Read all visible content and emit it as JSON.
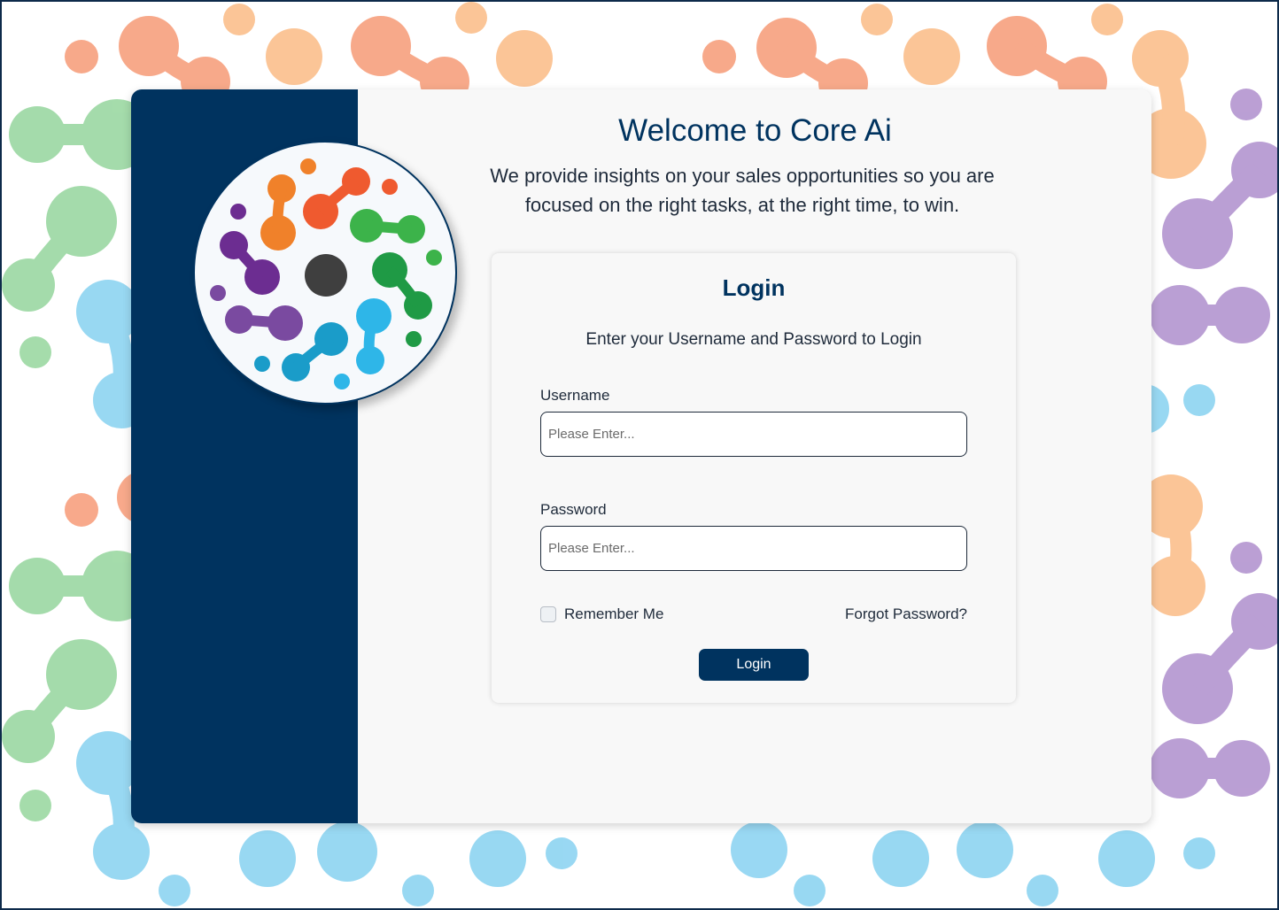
{
  "page": {
    "welcome_title": "Welcome to Core Ai",
    "welcome_description": "We provide insights on your sales opportunities so you are focused on the right tasks, at the right time, to win."
  },
  "login": {
    "title": "Login",
    "subtitle": "Enter your Username and Password to Login",
    "username_label": "Username",
    "username_placeholder": "Please Enter...",
    "username_value": "",
    "password_label": "Password",
    "password_placeholder": "Please Enter...",
    "password_value": "",
    "remember_me_label": "Remember Me",
    "remember_me_checked": false,
    "forgot_password_label": "Forgot Password?",
    "submit_label": "Login"
  },
  "colors": {
    "brand_navy": "#00335f",
    "panel_background": "#f8f8f8",
    "pattern_orange": "#f7a07e",
    "pattern_peach": "#fbbf8c",
    "pattern_green": "#9bd8a2",
    "pattern_blue": "#93d6f2",
    "pattern_purple": "#b79ad2"
  },
  "icons": {
    "logo": "core-ai-molecule-logo"
  }
}
